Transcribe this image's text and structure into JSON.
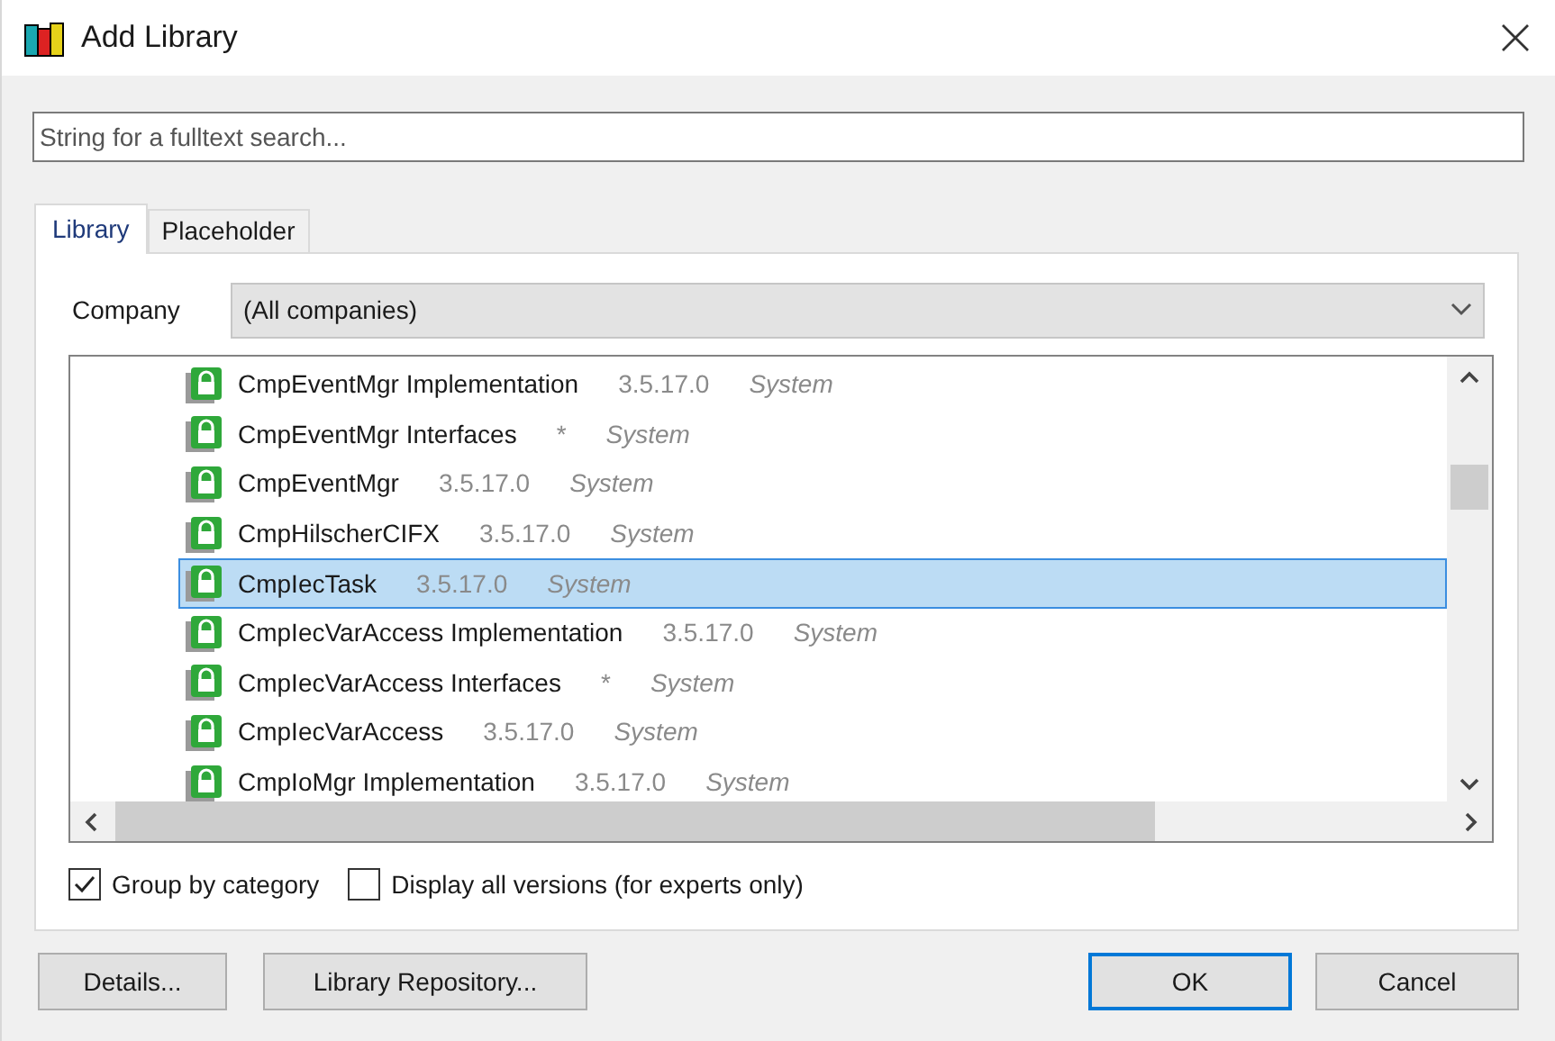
{
  "window": {
    "title": "Add Library"
  },
  "search": {
    "placeholder": "String for a fulltext search..."
  },
  "tabs": [
    {
      "label": "Library",
      "selected": true
    },
    {
      "label": "Placeholder",
      "selected": false
    }
  ],
  "company": {
    "label": "Company",
    "value": "(All companies)"
  },
  "libraries": [
    {
      "name": "CmpEventMgr Implementation",
      "version": "3.5.17.0",
      "category": "System",
      "selected": false
    },
    {
      "name": "CmpEventMgr Interfaces",
      "version": "*",
      "category": "System",
      "selected": false
    },
    {
      "name": "CmpEventMgr",
      "version": "3.5.17.0",
      "category": "System",
      "selected": false
    },
    {
      "name": "CmpHilscherCIFX",
      "version": "3.5.17.0",
      "category": "System",
      "selected": false
    },
    {
      "name": "CmpIecTask",
      "version": "3.5.17.0",
      "category": "System",
      "selected": true
    },
    {
      "name": "CmpIecVarAccess Implementation",
      "version": "3.5.17.0",
      "category": "System",
      "selected": false
    },
    {
      "name": "CmpIecVarAccess Interfaces",
      "version": "*",
      "category": "System",
      "selected": false
    },
    {
      "name": "CmpIecVarAccess",
      "version": "3.5.17.0",
      "category": "System",
      "selected": false
    },
    {
      "name": "CmpIoMgr Implementation",
      "version": "3.5.17.0",
      "category": "System",
      "selected": false
    }
  ],
  "options": [
    {
      "label": "Group by category",
      "checked": true
    },
    {
      "label": "Display all versions (for experts only)",
      "checked": false
    }
  ],
  "buttons_left": [
    "Details...",
    "Library Repository..."
  ],
  "buttons_right": [
    {
      "label": "OK",
      "default": true
    },
    {
      "label": "Cancel",
      "default": false
    }
  ]
}
